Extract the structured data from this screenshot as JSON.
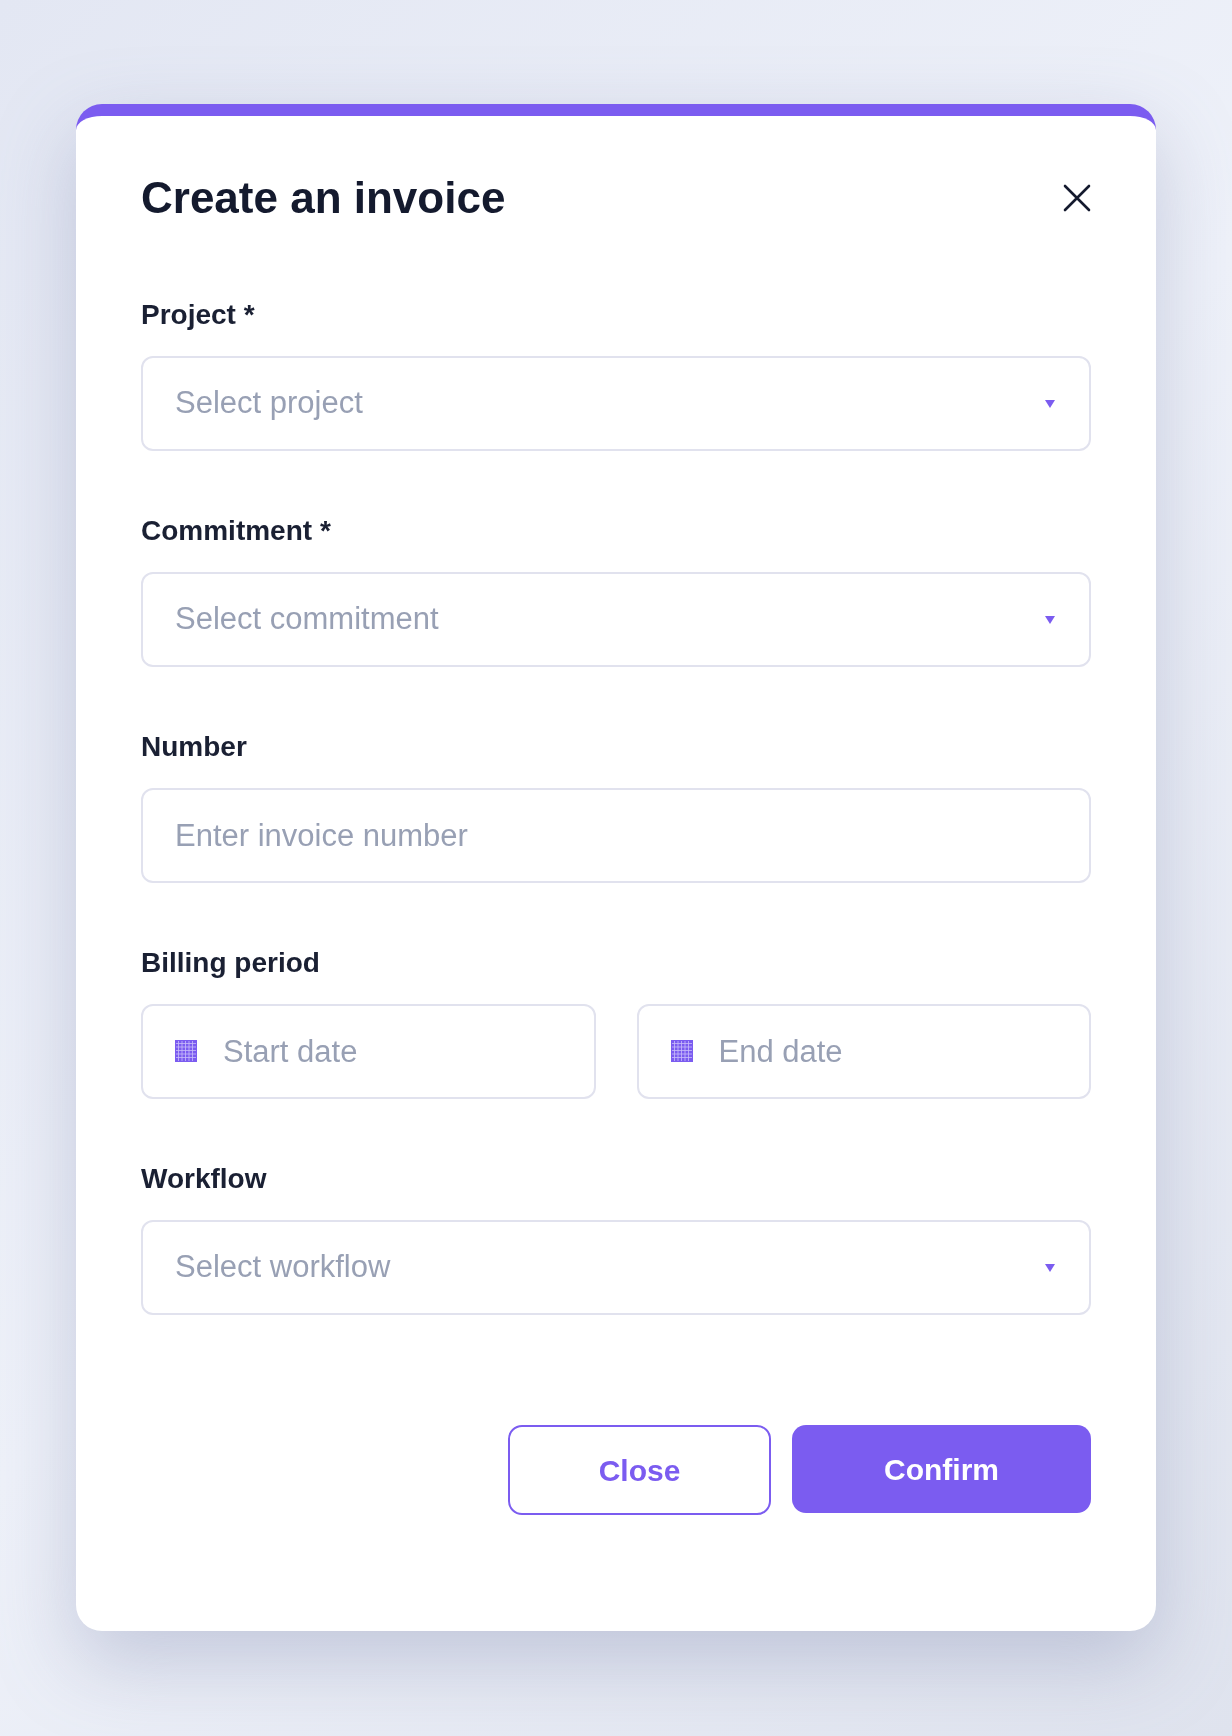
{
  "dialog": {
    "title": "Create an invoice",
    "fields": [
      {
        "kind": "select",
        "label": "Project *",
        "placeholder": "Select project"
      },
      {
        "kind": "select",
        "label": "Commitment *",
        "placeholder": "Select commitment"
      },
      {
        "kind": "text",
        "label": "Number",
        "placeholder": "Enter invoice number"
      },
      {
        "kind": "date_range",
        "label": "Billing period",
        "inputs": [
          {
            "placeholder": "Start date"
          },
          {
            "placeholder": "End date"
          }
        ]
      },
      {
        "kind": "select",
        "label": "Workflow",
        "placeholder": "Select workflow"
      }
    ],
    "buttons": [
      {
        "kind": "secondary",
        "label": "Close"
      },
      {
        "kind": "primary",
        "label": "Confirm"
      }
    ]
  }
}
